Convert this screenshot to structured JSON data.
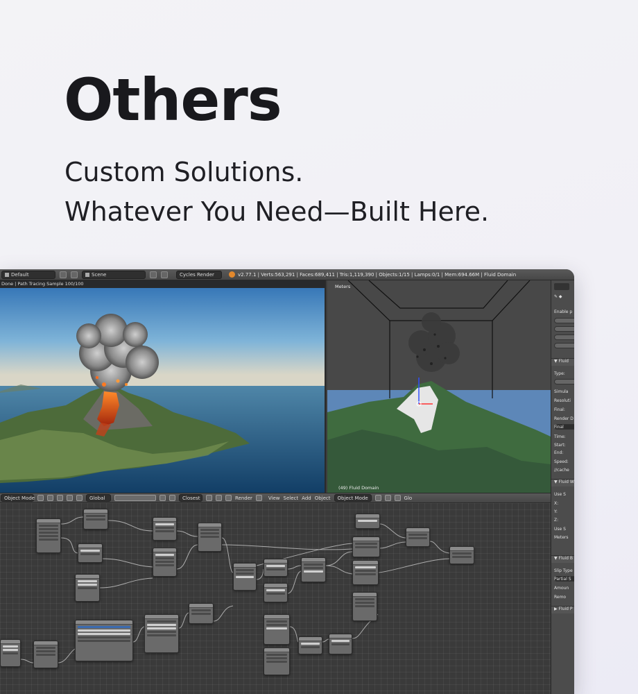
{
  "hero": {
    "title": "Others",
    "subtitle_line1": "Custom Solutions.",
    "subtitle_line2": "Whatever You Need—Built Here."
  },
  "app": {
    "topbar": {
      "layout": "Default",
      "scene": "Scene",
      "engine": "Cycles Render",
      "stats": "v2.77.1 | Verts:563,291 | Faces:689,411 | Tris:1,119,390 | Objects:1/15 | Lamps:0/1 | Mem:694.66M | Fluid Domain"
    },
    "render_view": {
      "status": "Done | Path Tracing Sample 100/100"
    },
    "viewport": {
      "units_label": "Meters",
      "object_label": "(49) Fluid Domain"
    },
    "header": {
      "mode": "Object Mode",
      "orientation": "Global",
      "proportional": "Closest",
      "render_label": "Render",
      "menus": [
        "View",
        "Select",
        "Add",
        "Object"
      ],
      "mode2": "Object Mode",
      "orientation2": "Glo"
    },
    "properties": {
      "enable_label": "Enable p",
      "fluid_section": "▼ Fluid",
      "type_label": "Type:",
      "simulate_label": "Simula",
      "resolution_label": "Resoluti",
      "final_label": "Final:",
      "render_display_label": "Render D",
      "final_value": "Final",
      "time_label": "Time:",
      "start_label": "Start:",
      "end_label": "End:",
      "speed_label": "Speed:",
      "cache_label": "//cache",
      "fluid_world_section": "▼ Fluid W",
      "use_label": "Use S",
      "x_label": "X:",
      "y_label": "Y:",
      "z_label": "Z:",
      "use_label2": "Use S",
      "meters_label": "Meters",
      "fluid_boundary_section": "▼ Fluid B",
      "slip_type_label": "Slip Type",
      "slip_value": "Partial S",
      "amount_label": "Amoun",
      "remove_label": "Remo",
      "fluid_particles_section": "▶ Fluid P"
    }
  }
}
